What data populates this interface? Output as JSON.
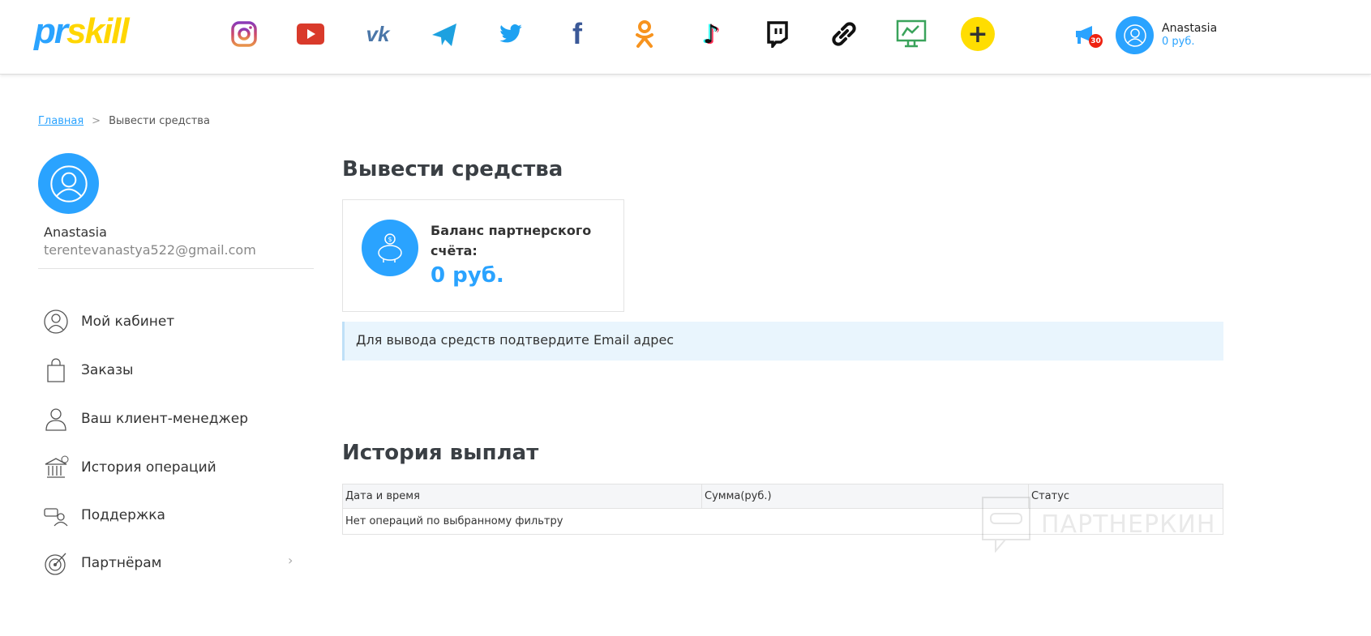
{
  "header": {
    "logo_part1": "pr",
    "logo_part2": "skill",
    "notifications_count": "30",
    "user_name": "Anastasia",
    "user_balance": "0 руб.",
    "icons": [
      "instagram-icon",
      "youtube-icon",
      "vk-icon",
      "telegram-icon",
      "twitter-icon",
      "facebook-icon",
      "odnoklassniki-icon",
      "tiktok-icon",
      "twitch-icon",
      "link-icon",
      "analytics-icon",
      "add-icon"
    ]
  },
  "breadcrumb": {
    "home": "Главная",
    "separator": ">",
    "current": "Вывести средства"
  },
  "profile": {
    "name": "Anastasia",
    "email": "terentevanastya522@gmail.com"
  },
  "sidebar": {
    "items": [
      {
        "label": "Мой кабинет"
      },
      {
        "label": "Заказы"
      },
      {
        "label": "Ваш клиент-менеджер"
      },
      {
        "label": "История операций"
      },
      {
        "label": "Поддержка"
      },
      {
        "label": "Партнёрам"
      }
    ]
  },
  "main": {
    "title": "Вывести средства",
    "balance_label": "Баланс партнерского счёта:",
    "balance_value": "0 руб.",
    "alert": "Для вывода средств подтвердите Email адрес",
    "history_title": "История выплат",
    "columns": [
      "Дата и время",
      "Сумма(руб.)",
      "Статус"
    ],
    "empty": "Нет операций по выбранному фильтру"
  },
  "watermark": "ПАРТНЕРКИН"
}
